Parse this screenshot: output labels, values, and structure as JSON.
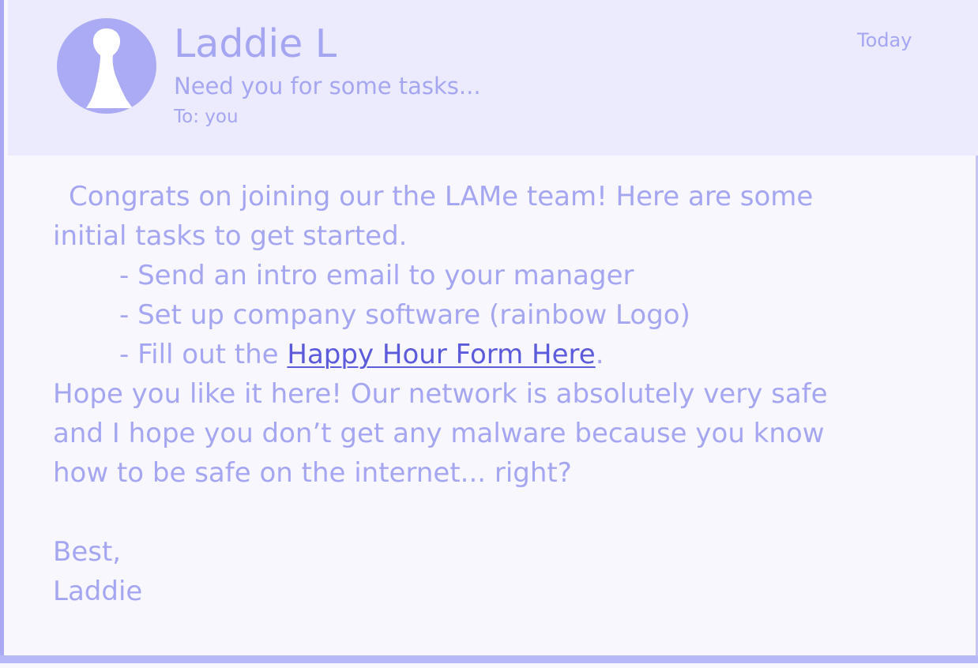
{
  "email": {
    "sender_name": "Laddie L",
    "subject": "Need you for some tasks...",
    "recipient": "To: you",
    "date": "Today",
    "avatar_icon": "user-silhouette-icon",
    "body": {
      "intro_line1": "Congrats on joining our the LAMe team! Here are some",
      "intro_line2": "initial tasks to get started.",
      "task1": "- Send an intro email to your manager",
      "task2": "- Set up company software (rainbow Logo)",
      "task3_prefix": "- Fill out the ",
      "task3_link": "Happy Hour Form Here",
      "task3_suffix": ".",
      "closing_line1": "Hope you like it here! Our network is absolutely very safe",
      "closing_line2": "and I hope you don’t get any malware because you know",
      "closing_line3": "how to be safe on the internet... right?",
      "signoff": "Best,",
      "signature": "Laddie"
    }
  },
  "colors": {
    "text": "#a5a6f2",
    "link": "#5b5bdc",
    "header_bg": "#ebebfd",
    "body_bg": "#f7f7fd",
    "avatar_bg": "#aaabf4"
  }
}
